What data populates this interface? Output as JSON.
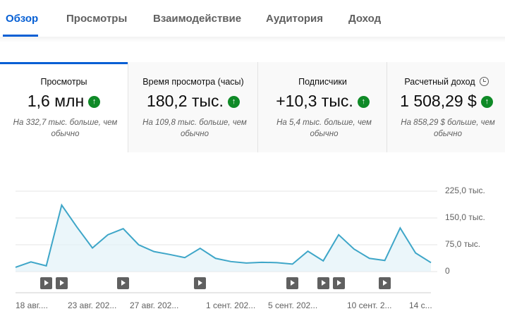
{
  "tabs": [
    {
      "label": "Обзор",
      "active": true
    },
    {
      "label": "Просмотры"
    },
    {
      "label": "Взаимодействие"
    },
    {
      "label": "Аудитория"
    },
    {
      "label": "Доход"
    }
  ],
  "metrics": [
    {
      "label": "Просмотры",
      "value": "1,6 млн",
      "trend": "up",
      "note": "На 332,7 тыс. больше, чем обычно"
    },
    {
      "label": "Время просмотра (часы)",
      "value": "180,2 тыс.",
      "trend": "up",
      "note": "На 109,8 тыс. больше, чем обычно"
    },
    {
      "label": "Подписчики",
      "value": "+10,3 тыс.",
      "trend": "up",
      "note": "На 5,4 тыс. больше, чем обычно"
    },
    {
      "label": "Расчетный доход",
      "value": "1 508,29 $",
      "trend": "up",
      "note": "На 858,29 $ больше, чем обычно"
    }
  ],
  "colors": {
    "accent": "#065fd4",
    "line": "#3ea6c8",
    "fill": "#e3f2f8",
    "up": "#0f8a27"
  },
  "chart_data": {
    "type": "area",
    "x": [
      1,
      2,
      3,
      4,
      5,
      6,
      7,
      8,
      9,
      10,
      11,
      12,
      13,
      14,
      15,
      16,
      17,
      18,
      19,
      20,
      21,
      22,
      23,
      24,
      25,
      26,
      27,
      28
    ],
    "values": [
      12,
      27,
      16,
      186,
      124,
      66,
      103,
      120,
      75,
      56,
      48,
      39,
      65,
      37,
      28,
      24,
      26,
      25,
      21,
      57,
      30,
      103,
      63,
      37,
      31,
      122,
      52,
      25
    ],
    "ylim": [
      0,
      225
    ],
    "y_ticks": [
      "225,0 тыс.",
      "150,0 тыс.",
      "75,0 тыс.",
      "0"
    ],
    "x_tick_labels": [
      "18 авг....",
      "23 авг. 202...",
      "27 авг. 202...",
      "1 сент. 202...",
      "5 сент. 202...",
      "10 сент. 2...",
      "14 с..."
    ],
    "video_markers_x": [
      3,
      4,
      8,
      13,
      19,
      21,
      22,
      25
    ],
    "grid": true
  }
}
